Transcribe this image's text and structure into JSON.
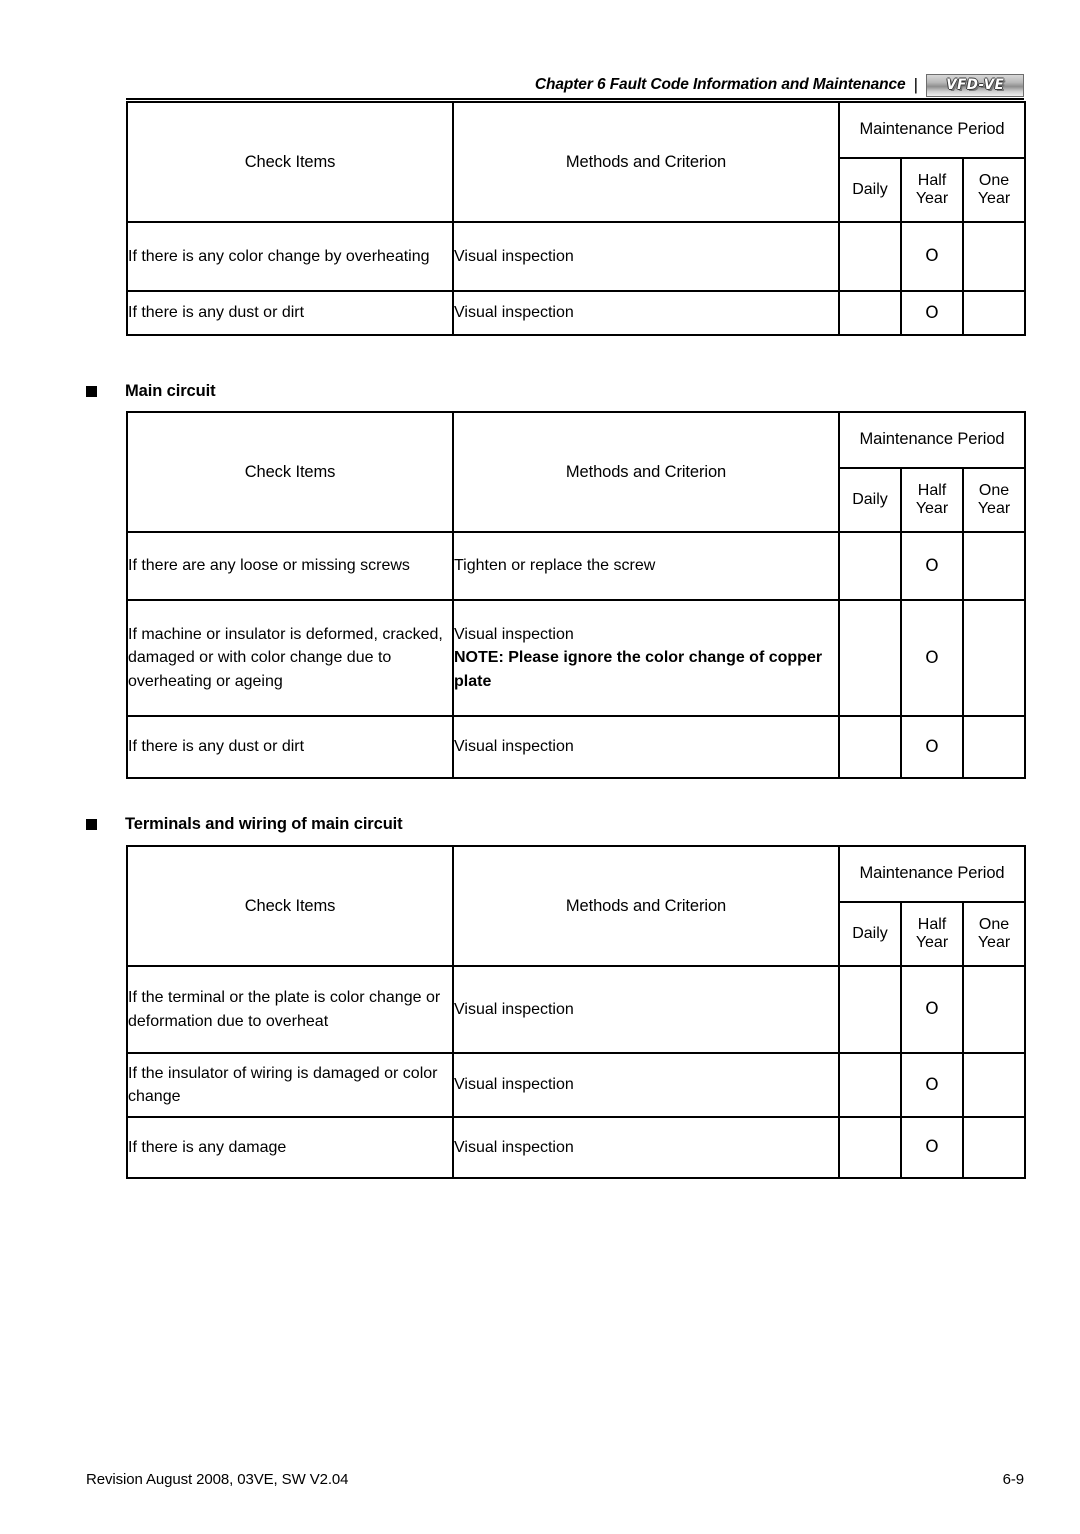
{
  "header": {
    "title": "Chapter 6 Fault Code Information and Maintenance",
    "separator": "|",
    "logo_text": "VFD-VE"
  },
  "table_headers": {
    "check_items": "Check Items",
    "methods": "Methods and Criterion",
    "maintenance_period": "Maintenance Period",
    "daily": "Daily",
    "half_year": "Half Year",
    "one_year": "One Year"
  },
  "mark": "O",
  "sections": [
    {
      "heading": "",
      "rows": [
        {
          "check": "If there is any color change by overheating",
          "method": "Visual inspection",
          "note": "",
          "daily": "",
          "half_year": "O",
          "one_year": ""
        },
        {
          "check": "If there is any dust or dirt",
          "method": "Visual inspection",
          "note": "",
          "daily": "",
          "half_year": "O",
          "one_year": ""
        }
      ]
    },
    {
      "heading": "Main circuit",
      "rows": [
        {
          "check": "If there are any loose or missing screws",
          "method": "Tighten or replace the screw",
          "note": "",
          "daily": "",
          "half_year": "O",
          "one_year": ""
        },
        {
          "check": "If machine or insulator is deformed, cracked, damaged or with color change due to overheating or ageing",
          "method": "Visual inspection",
          "note": "NOTE: Please ignore the color change of copper plate",
          "daily": "",
          "half_year": "O",
          "one_year": ""
        },
        {
          "check": "If there is any dust or dirt",
          "method": "Visual inspection",
          "note": "",
          "daily": "",
          "half_year": "O",
          "one_year": ""
        }
      ]
    },
    {
      "heading": "Terminals and wiring of main circuit",
      "rows": [
        {
          "check": "If the terminal or the plate is color change or deformation due to overheat",
          "method": "Visual inspection",
          "note": "",
          "daily": "",
          "half_year": "O",
          "one_year": ""
        },
        {
          "check": "If the insulator of wiring is damaged or color change",
          "method": "Visual inspection",
          "note": "",
          "daily": "",
          "half_year": "O",
          "one_year": ""
        },
        {
          "check": "If there is any damage",
          "method": "Visual inspection",
          "note": "",
          "daily": "",
          "half_year": "O",
          "one_year": ""
        }
      ]
    }
  ],
  "footer": {
    "revision": "Revision August 2008, 03VE, SW V2.04",
    "page_number": "6-9"
  }
}
